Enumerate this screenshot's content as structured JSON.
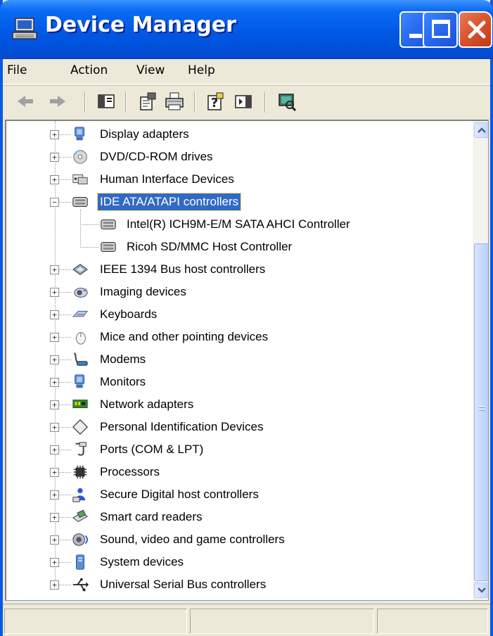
{
  "window": {
    "title": "Device Manager"
  },
  "menu": [
    "File",
    "Action",
    "View",
    "Help"
  ],
  "toolbar": [
    "back-icon",
    "forward-icon",
    "show-hide-console-tree-icon",
    "properties-icon",
    "print-icon",
    "help-icon",
    "action-pane-icon",
    "scan-hardware-icon"
  ],
  "tree": [
    {
      "label": "Display adapters",
      "icon": "display-adapter-icon",
      "expanded": false,
      "level": 1
    },
    {
      "label": "DVD/CD-ROM drives",
      "icon": "dvd-drive-icon",
      "expanded": false,
      "level": 1
    },
    {
      "label": "Human Interface Devices",
      "icon": "hid-icon",
      "expanded": false,
      "level": 1
    },
    {
      "label": "IDE ATA/ATAPI controllers",
      "icon": "ide-controller-icon",
      "expanded": true,
      "selected": true,
      "level": 1
    },
    {
      "label": "Intel(R) ICH9M-E/M SATA AHCI Controller",
      "icon": "ide-controller-icon",
      "level": 2
    },
    {
      "label": "Ricoh SD/MMC Host Controller",
      "icon": "ide-controller-icon",
      "level": 2
    },
    {
      "label": "IEEE 1394 Bus host controllers",
      "icon": "ieee1394-icon",
      "expanded": false,
      "level": 1
    },
    {
      "label": "Imaging devices",
      "icon": "imaging-device-icon",
      "expanded": false,
      "level": 1
    },
    {
      "label": "Keyboards",
      "icon": "keyboard-icon",
      "expanded": false,
      "level": 1
    },
    {
      "label": "Mice and other pointing devices",
      "icon": "mouse-icon",
      "expanded": false,
      "level": 1
    },
    {
      "label": "Modems",
      "icon": "modem-icon",
      "expanded": false,
      "level": 1
    },
    {
      "label": "Monitors",
      "icon": "monitor-icon",
      "expanded": false,
      "level": 1
    },
    {
      "label": "Network adapters",
      "icon": "network-adapter-icon",
      "expanded": false,
      "level": 1
    },
    {
      "label": "Personal Identification Devices",
      "icon": "identification-device-icon",
      "expanded": false,
      "level": 1
    },
    {
      "label": "Ports (COM & LPT)",
      "icon": "port-icon",
      "expanded": false,
      "level": 1
    },
    {
      "label": "Processors",
      "icon": "processor-icon",
      "expanded": false,
      "level": 1
    },
    {
      "label": "Secure Digital host controllers",
      "icon": "sd-host-icon",
      "expanded": false,
      "level": 1
    },
    {
      "label": "Smart card readers",
      "icon": "smart-card-reader-icon",
      "expanded": false,
      "level": 1
    },
    {
      "label": "Sound, video and game controllers",
      "icon": "sound-icon",
      "expanded": false,
      "level": 1
    },
    {
      "label": "System devices",
      "icon": "system-device-icon",
      "expanded": false,
      "level": 1
    },
    {
      "label": "Universal Serial Bus controllers",
      "icon": "usb-icon",
      "expanded": false,
      "level": 1
    }
  ],
  "colors": {
    "titlebar": "#0058E6",
    "selection": "#316AC5",
    "chrome": "#ECE9D8"
  }
}
